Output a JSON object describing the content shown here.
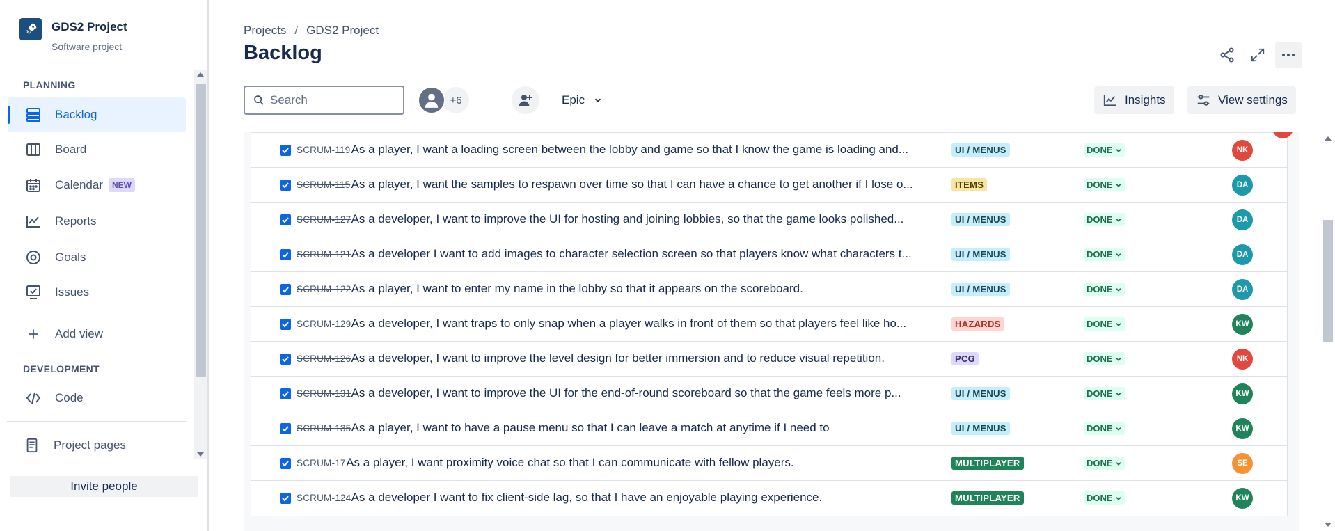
{
  "sidebar": {
    "project_name": "GDS2 Project",
    "project_type": "Software project",
    "section_planning": "PLANNING",
    "section_development": "DEVELOPMENT",
    "items": [
      {
        "label": "Backlog",
        "icon": "backlog-icon"
      },
      {
        "label": "Board",
        "icon": "board-icon"
      },
      {
        "label": "Calendar",
        "icon": "calendar-icon",
        "badge": "NEW"
      },
      {
        "label": "Reports",
        "icon": "reports-icon"
      },
      {
        "label": "Goals",
        "icon": "goals-icon"
      },
      {
        "label": "Issues",
        "icon": "issues-icon"
      },
      {
        "label": "Add view",
        "icon": "plus-icon"
      },
      {
        "label": "Code",
        "icon": "code-icon"
      },
      {
        "label": "Project pages",
        "icon": "pages-icon"
      }
    ],
    "invite_label": "Invite people"
  },
  "header": {
    "breadcrumb": [
      "Projects",
      "GDS2 Project"
    ],
    "breadcrumb_sep": "/",
    "title": "Backlog"
  },
  "toolbar": {
    "search_placeholder": "Search",
    "avatar_more": "+6",
    "epic_label": "Epic",
    "insights_label": "Insights",
    "view_settings_label": "View settings"
  },
  "colors": {
    "accent": "#0c66e4",
    "epic_ui_bg": "#c6edfb",
    "epic_ui_fg": "#164555",
    "epic_items_bg": "#f8e6a0",
    "epic_items_fg": "#533f04",
    "epic_hazards_bg": "#ffd5d2",
    "epic_hazards_fg": "#ae2e24",
    "epic_pcg_bg": "#dfd8fd",
    "epic_pcg_fg": "#352c63",
    "epic_mp_bg": "#1f845a",
    "epic_mp_fg": "#ffffff"
  },
  "backlog": {
    "status_label": "DONE",
    "rows": [
      {
        "key": "SCRUM-119",
        "summary": "As a player, I want a loading screen between the lobby and game so that I know the game is loading and...",
        "epic": "UI / MENUS",
        "epic_style": "ui",
        "assignee": "NK",
        "assignee_color": "#e2483d"
      },
      {
        "key": "SCRUM-115",
        "summary": "As a player, I want the samples to respawn over time so that I can have a chance to get another if I lose o...",
        "epic": "ITEMS",
        "epic_style": "items",
        "assignee": "DA",
        "assignee_color": "#1d9aaa"
      },
      {
        "key": "SCRUM-127",
        "summary": "As a developer, I want to improve the UI for hosting and joining lobbies, so that the game looks polished...",
        "epic": "UI / MENUS",
        "epic_style": "ui",
        "assignee": "DA",
        "assignee_color": "#1d9aaa"
      },
      {
        "key": "SCRUM-121",
        "summary": "As a developer I want to add images to character selection screen so that players know what characters t...",
        "epic": "UI / MENUS",
        "epic_style": "ui",
        "assignee": "DA",
        "assignee_color": "#1d9aaa"
      },
      {
        "key": "SCRUM-122",
        "summary": "As a player, I want to enter my name in the lobby so that it appears on the scoreboard.",
        "epic": "UI / MENUS",
        "epic_style": "ui",
        "assignee": "DA",
        "assignee_color": "#1d9aaa"
      },
      {
        "key": "SCRUM-129",
        "summary": "As a developer, I want traps to only snap when a player walks in front of them so that players feel like ho...",
        "epic": "HAZARDS",
        "epic_style": "hazards",
        "assignee": "KW",
        "assignee_color": "#1f845a"
      },
      {
        "key": "SCRUM-126",
        "summary": "As a developer, I want to improve the level design for better immersion and to reduce visual repetition.",
        "epic": "PCG",
        "epic_style": "pcg",
        "assignee": "NK",
        "assignee_color": "#e2483d"
      },
      {
        "key": "SCRUM-131",
        "summary": "As a developer, I want to improve the UI for the end-of-round scoreboard so that the game feels more p...",
        "epic": "UI / MENUS",
        "epic_style": "ui",
        "assignee": "KW",
        "assignee_color": "#1f845a"
      },
      {
        "key": "SCRUM-135",
        "summary": "As a player, I want to have a pause menu so that I can leave a match at anytime if I need to",
        "epic": "UI / MENUS",
        "epic_style": "ui",
        "assignee": "KW",
        "assignee_color": "#1f845a"
      },
      {
        "key": "SCRUM-17",
        "summary": "As a player, I want proximity voice chat so that I can communicate with fellow players.",
        "epic": "MULTIPLAYER",
        "epic_style": "mp",
        "assignee": "SE",
        "assignee_color": "#f79232"
      },
      {
        "key": "SCRUM-124",
        "summary": "As a developer I want to fix client-side lag, so that I have an enjoyable playing experience.",
        "epic": "MULTIPLAYER",
        "epic_style": "mp",
        "assignee": "KW",
        "assignee_color": "#1f845a"
      }
    ]
  }
}
